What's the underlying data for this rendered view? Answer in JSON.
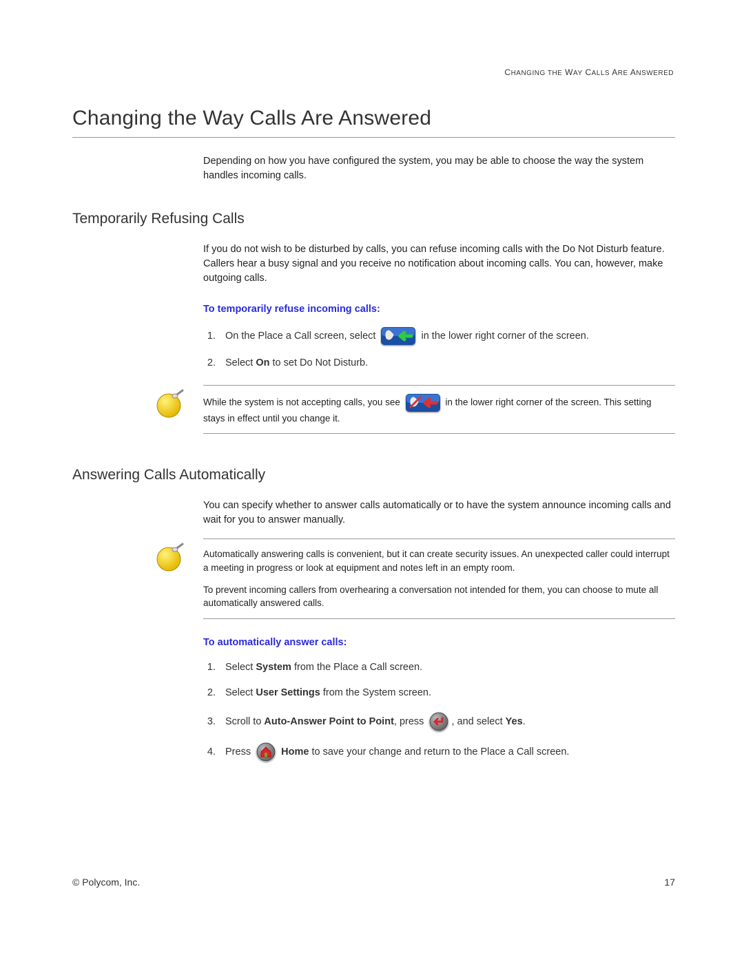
{
  "running_header": "Changing the Way Calls Are Answered",
  "title": "Changing the Way Calls Are Answered",
  "intro": "Depending on how you have configured the system, you may be able to choose the way the system handles incoming calls.",
  "section1": {
    "heading": "Temporarily Refusing Calls",
    "body": "If you do not wish to be disturbed by calls, you can refuse incoming calls with the Do Not Disturb feature. Callers hear a busy signal and you receive no notification about incoming calls. You can, however, make outgoing calls.",
    "proc_head": "To temporarily refuse incoming calls:",
    "step1_a": "On the Place a Call screen, select ",
    "step1_b": " in the lower right corner of the screen.",
    "step2_a": "Select ",
    "step2_on": "On",
    "step2_b": " to set Do Not Disturb.",
    "note_a": "While the system is not accepting calls, you see ",
    "note_b": " in the lower right corner of the screen. This setting stays in effect until you change it."
  },
  "section2": {
    "heading": "Answering Calls Automatically",
    "body": "You can specify whether to answer calls automatically or to have the system announce incoming calls and wait for you to answer manually.",
    "note_p1": "Automatically answering calls is convenient, but it can create security issues. An unexpected caller could interrupt a meeting in progress or look at equipment and notes left in an empty room.",
    "note_p2": "To prevent incoming callers from overhearing a conversation not intended for them, you can choose to mute all automatically answered calls.",
    "proc_head": "To automatically answer calls:",
    "step1_a": "Select ",
    "step1_sys": "System",
    "step1_b": " from the Place a Call screen.",
    "step2_a": "Select ",
    "step2_us": "User Settings",
    "step2_b": " from the System screen.",
    "step3_a": "Scroll to ",
    "step3_b": "Auto-Answer Point to Point",
    "step3_c": ", press ",
    "step3_d": ", and select ",
    "step3_yes": "Yes",
    "step3_e": ".",
    "step4_a": "Press ",
    "step4_home": "Home",
    "step4_b": " to save your change and return to the Place a Call screen."
  },
  "footer_left": "© Polycom, Inc.",
  "footer_right": "17"
}
